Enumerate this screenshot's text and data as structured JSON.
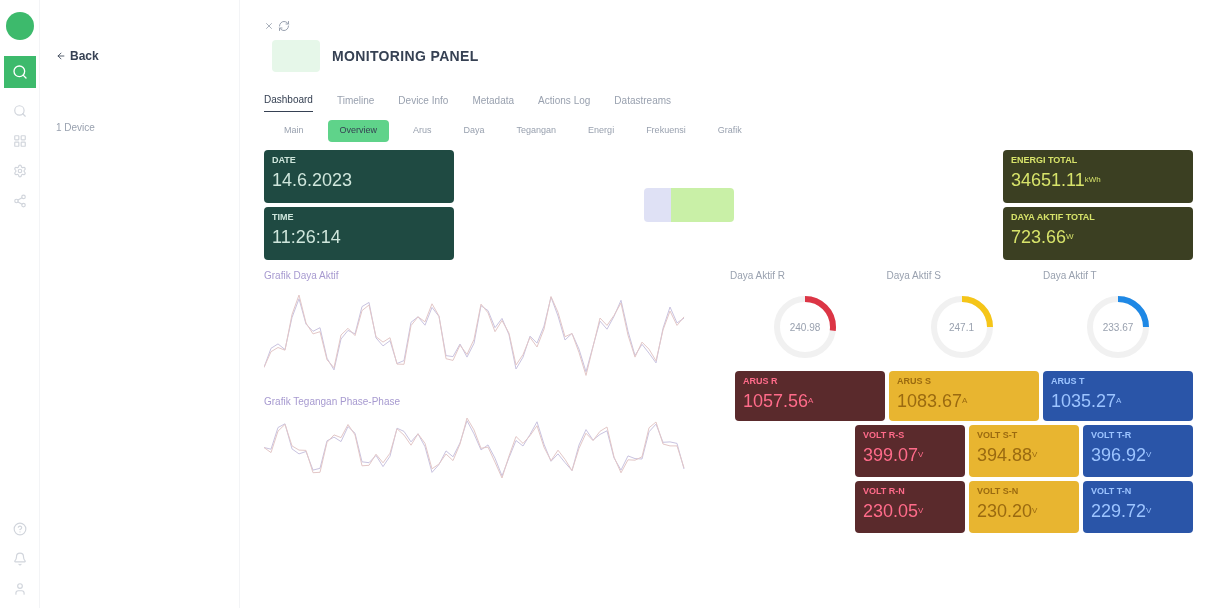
{
  "sidebar": {
    "back": "Back",
    "devices_label": "1 Device"
  },
  "header": {
    "title": "MONITORING PANEL"
  },
  "tabs": [
    {
      "label": "Dashboard",
      "selected": true
    },
    {
      "label": "Timeline",
      "selected": false
    },
    {
      "label": "Device Info",
      "selected": false
    },
    {
      "label": "Metadata",
      "selected": false
    },
    {
      "label": "Actions Log",
      "selected": false
    },
    {
      "label": "Datastreams",
      "selected": false
    }
  ],
  "sub_tabs": [
    {
      "label": "Main",
      "selected": false
    },
    {
      "label": "Overview",
      "selected": true
    },
    {
      "label": "Arus",
      "selected": false
    },
    {
      "label": "Daya",
      "selected": false
    },
    {
      "label": "Tegangan",
      "selected": false
    },
    {
      "label": "Energi",
      "selected": false
    },
    {
      "label": "Frekuensi",
      "selected": false
    },
    {
      "label": "Grafik",
      "selected": false
    }
  ],
  "left_cards": [
    {
      "label": "DATE",
      "value": "14.6.2023"
    },
    {
      "label": "TIME",
      "value": "11:26:14"
    }
  ],
  "right_cards": [
    {
      "label": "ENERGI TOTAL",
      "value": "34651.11",
      "unit": "kWh"
    },
    {
      "label": "DAYA AKTIF TOTAL",
      "value": "723.66",
      "unit": "W"
    }
  ],
  "chart_titles": [
    "Grafik Daya Aktif",
    "Grafik Tegangan Phase-Phase"
  ],
  "gauges": [
    {
      "label": "Daya Aktif R",
      "value": "240.98",
      "level": 0.27,
      "color": "#dc3545"
    },
    {
      "label": "Daya Aktif S",
      "value": "247.1",
      "level": 0.25,
      "color": "#f5c518"
    },
    {
      "label": "Daya Aktif T",
      "value": "233.67",
      "level": 0.25,
      "color": "#1e88e5"
    }
  ],
  "current_cards": [
    {
      "label": "ARUS R",
      "value": "1057.56",
      "unit": "A",
      "color": "#5a2a2c"
    },
    {
      "label": "ARUS S",
      "value": "1083.67",
      "unit": "A",
      "color": "#e8b530"
    },
    {
      "label": "ARUS T",
      "value": "1035.27",
      "unit": "A",
      "color": "#2a55a8"
    }
  ],
  "voltage_cards": [
    {
      "label": "VOLT R-S",
      "value": "399.07",
      "unit": "V",
      "color": "#5a2a2c"
    },
    {
      "label": "VOLT S-T",
      "value": "394.88",
      "unit": "V",
      "color": "#e8b530"
    },
    {
      "label": "VOLT T-R",
      "value": "396.92",
      "unit": "V",
      "color": "#2a55a8"
    },
    {
      "label": "VOLT R-N",
      "value": "230.05",
      "unit": "V",
      "color": "#5a2a2c"
    },
    {
      "label": "VOLT S-N",
      "value": "230.20",
      "unit": "V",
      "color": "#e8b530"
    },
    {
      "label": "VOLT T-N",
      "value": "229.72",
      "unit": "V",
      "color": "#2a55a8"
    }
  ]
}
